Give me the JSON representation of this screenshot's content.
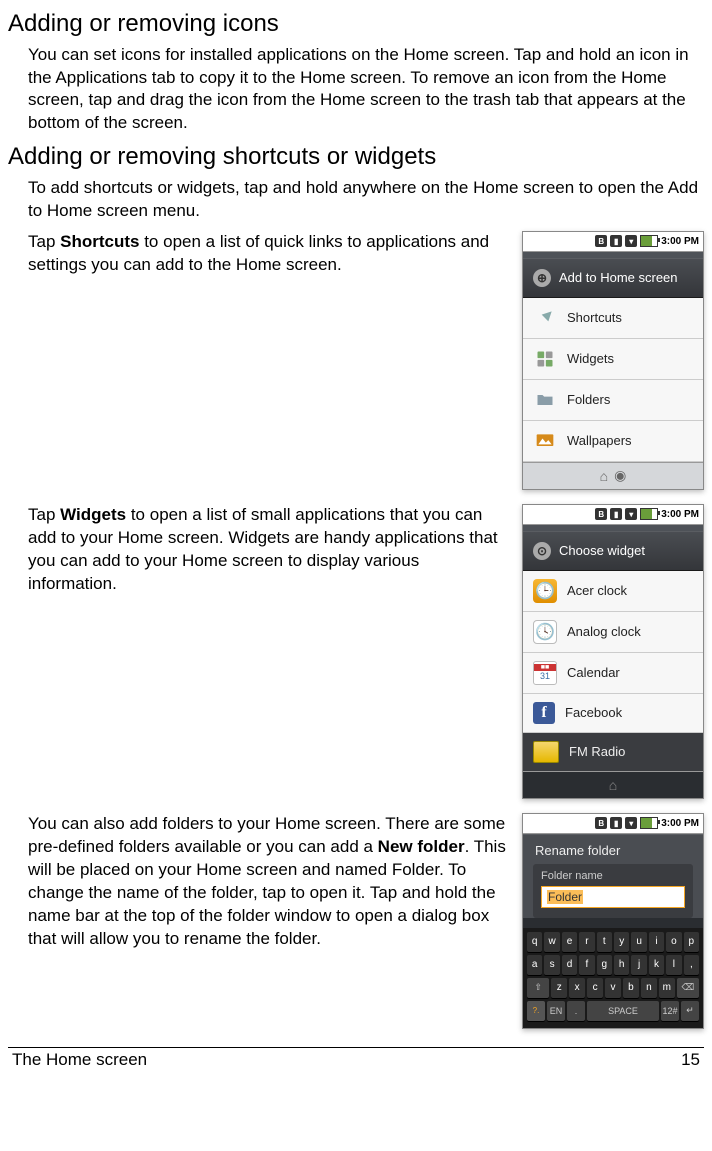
{
  "heading1": "Adding or removing icons",
  "para1": "You can set icons for installed applications on the Home screen. Tap and hold an icon in the Applications tab to copy it to the Home screen. To remove an icon from the Home screen, tap and drag the icon from the Home screen to the trash tab that appears at the bottom of the screen.",
  "heading2": "Adding or removing shortcuts or widgets",
  "para2": "To add shortcuts or widgets, tap and hold anywhere on the Home screen to open the Add to Home screen menu.",
  "shortcuts_para_pre": "Tap ",
  "shortcuts_bold": "Shortcuts",
  "shortcuts_para_post": " to open a list of quick links to applications and settings you can add to the Home screen.",
  "widgets_para_pre": "Tap ",
  "widgets_bold": "Widgets",
  "widgets_para_post": " to open a list of small applications that you can add to your Home screen. Widgets are handy applications that you can add to your Home screen to display various information.",
  "folders_para_pre": "You can also add folders to your Home screen. There are some pre-defined folders available or you can add a ",
  "folders_bold": "New folder",
  "folders_para_post": ". This will be placed on your Home screen and named Folder. To change the name of the folder, tap to open it. Tap and hold the name bar at the top of the folder window to open a dialog box that will allow you to rename the folder.",
  "status_time": "3:00 PM",
  "phone1": {
    "header": "Add to Home screen",
    "items": [
      "Shortcuts",
      "Widgets",
      "Folders",
      "Wallpapers"
    ]
  },
  "phone2": {
    "header": "Choose widget",
    "items": [
      "Acer clock",
      "Analog clock",
      "Calendar",
      "Facebook",
      "FM Radio"
    ]
  },
  "phone3": {
    "title": "Rename folder",
    "field_label": "Folder name",
    "field_value": "Folder"
  },
  "kbd": {
    "r1": [
      "q",
      "w",
      "e",
      "r",
      "t",
      "y",
      "u",
      "i",
      "o",
      "p"
    ],
    "r2": [
      "a",
      "s",
      "d",
      "f",
      "g",
      "h",
      "j",
      "k",
      "l",
      ","
    ],
    "r3": [
      "⇧",
      "z",
      "x",
      "c",
      "v",
      "b",
      "n",
      "m",
      "⌫"
    ],
    "r4": [
      "?.",
      "EN",
      ".",
      "SPACE",
      "12#",
      "↵"
    ]
  },
  "footer_left": "The Home screen",
  "footer_right": "15"
}
